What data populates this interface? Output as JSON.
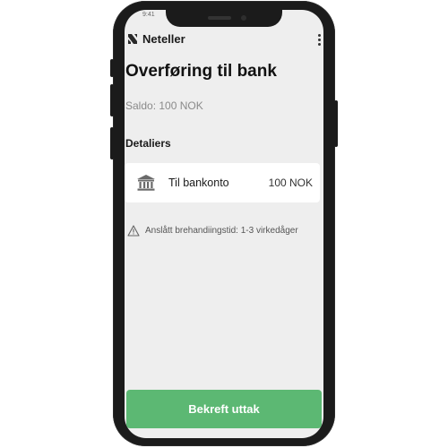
{
  "status_bar": {
    "time": "9:41"
  },
  "header": {
    "brand_name": "Neteller",
    "menu_icon": "more-vertical-icon"
  },
  "page": {
    "title": "Overføring til bank",
    "balance": "Saldo: 100 NOK"
  },
  "details": {
    "heading": "Detaliers",
    "item": {
      "icon": "bank-icon",
      "label": "Til bankonto",
      "amount": "100 NOK"
    }
  },
  "notice": {
    "icon": "warning-icon",
    "text": "Anslått brehandiingstid: 1-3 virkedåger"
  },
  "actions": {
    "confirm_label": "Bekreft uttak"
  },
  "colors": {
    "accent": "#5cb873",
    "screen_background": "#eeeeee",
    "phone_frame": "#1b1b1b"
  }
}
